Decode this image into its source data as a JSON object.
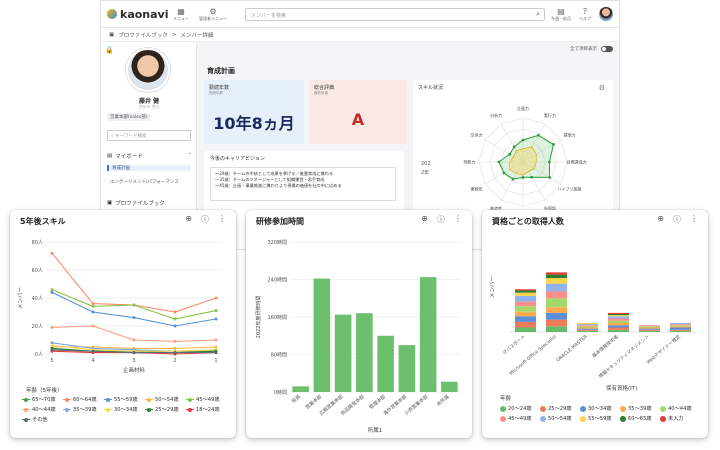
{
  "app": {
    "logo_text": "kaonavi",
    "nav": [
      {
        "label": "メニュー",
        "icon": "grid-icon"
      },
      {
        "label": "管理者メニュー",
        "icon": "gear-icon"
      }
    ],
    "search_placeholder": "メンバーを検索",
    "right_nav": [
      {
        "label": "今週・前月",
        "icon": "clipboard-icon"
      },
      {
        "label": "ヘルプ",
        "icon": "help-icon"
      }
    ]
  },
  "breadcrumb": {
    "root": "プロファイルブック",
    "sep": ">",
    "current": "メンバー詳細"
  },
  "profile": {
    "name": "藤井 健",
    "kana": "フジイ ケン",
    "dept": "営業本部(sales部)"
  },
  "sidebar": {
    "keyword_placeholder": "キーワード検索",
    "my_board": "マイボード",
    "items": [
      "育成計画",
      "エンゲージメント/パフォーマンス"
    ],
    "profile_book": "プロファイルブック"
  },
  "main": {
    "toggle_label": "全て項目表示",
    "section_title": "育成計画",
    "years_card": {
      "label": "勤続年数",
      "sub": "勤続年数",
      "value": "10年8ヵ月"
    },
    "eval_card": {
      "label": "総合評価",
      "sub": "最終評価",
      "value": "A"
    },
    "career": {
      "title": "今後のキャリアビジョン",
      "lines": [
        "〜29歳：チームの中核として成果を挙げる／後輩育成に携わる",
        "〜35歳：チームのマネージャーとして組織運営・若手育成",
        "〜45歳：企画・事業推進に携わりより現場の価値を社の中に広める"
      ]
    },
    "skill": {
      "title": "スキル状況",
      "year_labels": [
        "202",
        "2年"
      ]
    }
  },
  "radar": {
    "axes": [
      "企画力",
      "実行力",
      "提案力",
      "目標達成力",
      "ハイブリ英語",
      "外国語",
      "協調性",
      "創造性",
      "柔軟性",
      "判断力",
      "交渉力",
      "分析力"
    ],
    "outer": [
      0.5,
      0.7,
      0.8,
      0.6,
      0.7,
      0.4,
      0.35,
      0.45,
      0.5,
      0.55,
      0.35,
      0.4
    ],
    "inner": [
      0.3,
      0.4,
      0.35,
      0.3,
      0.3,
      0.25,
      0.3,
      0.3,
      0.35,
      0.3,
      0.25,
      0.3
    ]
  },
  "panel1": {
    "title": "5年後スキル",
    "legend_title": "年齢（5年後）",
    "legend": [
      {
        "label": "65〜70歳",
        "color": "#43a047"
      },
      {
        "label": "60〜64歳",
        "color": "#ff8a65"
      },
      {
        "label": "55〜59歳",
        "color": "#5b8fd9"
      },
      {
        "label": "50〜54歳",
        "color": "#ffb74d"
      },
      {
        "label": "45〜49歳",
        "color": "#8bc34a"
      },
      {
        "label": "40〜44歳",
        "color": "#ff9e80"
      },
      {
        "label": "35〜39歳",
        "color": "#7fa7e0"
      },
      {
        "label": "30〜34歳",
        "color": "#ffd54f"
      },
      {
        "label": "25〜29歳",
        "color": "#2e7d32"
      },
      {
        "label": "18〜24歳",
        "color": "#e53935"
      },
      {
        "label": "その他",
        "color": "#546e7a"
      }
    ]
  },
  "panel2": {
    "title": "研修参加時間"
  },
  "panel3": {
    "title": "資格ごとの取得人数",
    "legend_title": "年齢"
  },
  "chart_data": [
    {
      "type": "line",
      "title": "5年後スキル",
      "xlabel": "企画材料",
      "ylabel": "メンバー",
      "categories": [
        "5",
        "4",
        "3",
        "2",
        "1"
      ],
      "ylim": [
        0,
        80
      ],
      "yticks": [
        "0人",
        "20人",
        "40人",
        "60人",
        "80人"
      ],
      "series": [
        {
          "name": "65〜70歳",
          "color": "#43a047",
          "values": [
            3,
            2,
            2,
            1,
            2
          ]
        },
        {
          "name": "60〜64歳",
          "color": "#ff8a65",
          "values": [
            72,
            36,
            35,
            30,
            40
          ]
        },
        {
          "name": "55〜59歳",
          "color": "#5b8fd9",
          "values": [
            44,
            30,
            26,
            20,
            25
          ]
        },
        {
          "name": "50〜54歳",
          "color": "#ffb74d",
          "values": [
            5,
            5,
            4,
            4,
            5
          ]
        },
        {
          "name": "45〜49歳",
          "color": "#8bc34a",
          "values": [
            46,
            34,
            35,
            25,
            31
          ]
        },
        {
          "name": "40〜44歳",
          "color": "#ff9e80",
          "values": [
            19,
            20,
            10,
            9,
            10
          ]
        },
        {
          "name": "35〜39歳",
          "color": "#7fa7e0",
          "values": [
            8,
            4,
            3,
            2,
            3
          ]
        },
        {
          "name": "30〜34歳",
          "color": "#ffd54f",
          "values": [
            6,
            3,
            2,
            2,
            3
          ]
        },
        {
          "name": "25〜29歳",
          "color": "#2e7d32",
          "values": [
            4,
            2,
            1,
            1,
            2
          ]
        },
        {
          "name": "18〜24歳",
          "color": "#e53935",
          "values": [
            2,
            1,
            1,
            0,
            1
          ]
        },
        {
          "name": "その他",
          "color": "#546e7a",
          "values": [
            3,
            2,
            1,
            1,
            1
          ]
        }
      ]
    },
    {
      "type": "bar",
      "title": "研修参加時間",
      "xlabel": "所属1",
      "ylabel": "2022年度研修時間",
      "categories": [
        "役員",
        "営業本部",
        "広報営業本部",
        "商品開発本部",
        "管理本部",
        "海外営業本部",
        "小売営業本部",
        "未所属"
      ],
      "values": [
        12,
        242,
        165,
        168,
        120,
        100,
        245,
        22
      ],
      "ylim": [
        0,
        320
      ],
      "yticks": [
        "0時間",
        "80時間",
        "160時間",
        "240時間",
        "320時間"
      ],
      "color": "#6cbf6c"
    },
    {
      "type": "bar",
      "stacked": true,
      "title": "資格ごとの取得人数",
      "xlabel": "保有資格(IT)",
      "ylabel": "メンバー",
      "categories": [
        "ITパスポート",
        "Microsoft Office Specialist",
        "ORACLE MASTER",
        "基本情報技術者",
        "情報セキュリティマネジメント",
        "Webデザイナー検定"
      ],
      "ylim": [
        0,
        80
      ],
      "series": [
        {
          "name": "20〜24歳",
          "color": "#66bb6a",
          "values": [
            4,
            5,
            1,
            2,
            1,
            1
          ]
        },
        {
          "name": "25〜29歳",
          "color": "#ef7b5a",
          "values": [
            5,
            6,
            1,
            2,
            1,
            1
          ]
        },
        {
          "name": "30〜34歳",
          "color": "#5b8fd9",
          "values": [
            5,
            6,
            1,
            2,
            1,
            2
          ]
        },
        {
          "name": "35〜39歳",
          "color": "#ffa94d",
          "values": [
            4,
            5,
            1,
            2,
            1,
            1
          ]
        },
        {
          "name": "40〜44歳",
          "color": "#a5d86b",
          "values": [
            5,
            8,
            1,
            2,
            1,
            1
          ]
        },
        {
          "name": "45〜49歳",
          "color": "#ff8f8f",
          "values": [
            4,
            6,
            1,
            2,
            1,
            1
          ]
        },
        {
          "name": "50〜54歳",
          "color": "#8fb3ea",
          "values": [
            5,
            7,
            1,
            2,
            0,
            1
          ]
        },
        {
          "name": "55〜59歳",
          "color": "#ffd54f",
          "values": [
            3,
            5,
            1,
            1,
            0,
            0
          ]
        },
        {
          "name": "60〜65歳",
          "color": "#2e7d32",
          "values": [
            2,
            3,
            0,
            1,
            0,
            0
          ]
        },
        {
          "name": "未入力",
          "color": "#e53935",
          "values": [
            1,
            2,
            0,
            1,
            0,
            0
          ]
        }
      ]
    }
  ]
}
